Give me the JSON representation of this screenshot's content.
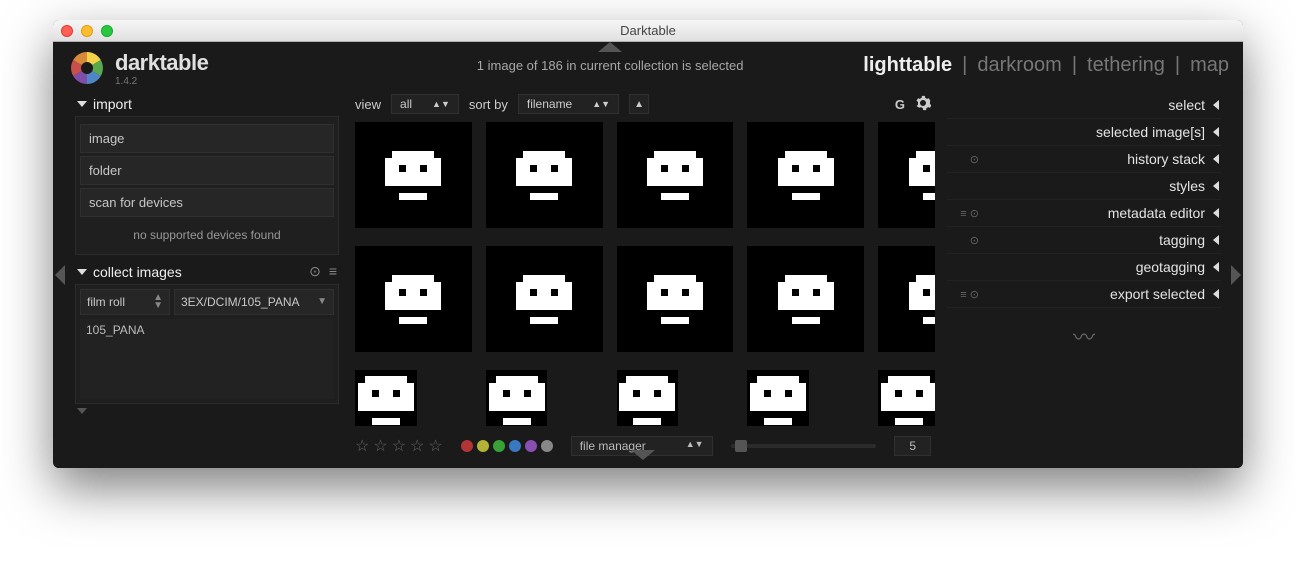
{
  "window": {
    "title": "Darktable"
  },
  "brand": {
    "name": "darktable",
    "version": "1.4.2"
  },
  "status": "1 image of 186 in current collection is selected",
  "views": {
    "items": [
      "lighttable",
      "darkroom",
      "tethering",
      "map"
    ],
    "active": 0
  },
  "left": {
    "import": {
      "title": "import",
      "buttons": [
        "image",
        "folder",
        "scan for devices"
      ],
      "info": "no supported devices found"
    },
    "collect": {
      "title": "collect images",
      "rule_type": "film roll",
      "rule_path": "3EX/DCIM/105_PANA",
      "list": [
        "105_PANA"
      ]
    }
  },
  "toolbar": {
    "view_label": "view",
    "view_value": "all",
    "sort_label": "sort by",
    "sort_value": "filename",
    "grouping": "G"
  },
  "footer": {
    "layout_value": "file manager",
    "zoom": "5",
    "swatch_colors": [
      "#b23434",
      "#b2b234",
      "#38a238",
      "#3a78c2",
      "#8a4fb2",
      "#888888"
    ]
  },
  "right": {
    "items": [
      {
        "pre": "",
        "label": "select"
      },
      {
        "pre": "",
        "label": "selected image[s]"
      },
      {
        "pre": "⊙",
        "label": "history stack"
      },
      {
        "pre": "",
        "label": "styles"
      },
      {
        "pre": "≡ ⊙",
        "label": "metadata editor"
      },
      {
        "pre": "⊙",
        "label": "tagging"
      },
      {
        "pre": "",
        "label": "geotagging"
      },
      {
        "pre": "≡ ⊙",
        "label": "export selected"
      }
    ]
  }
}
